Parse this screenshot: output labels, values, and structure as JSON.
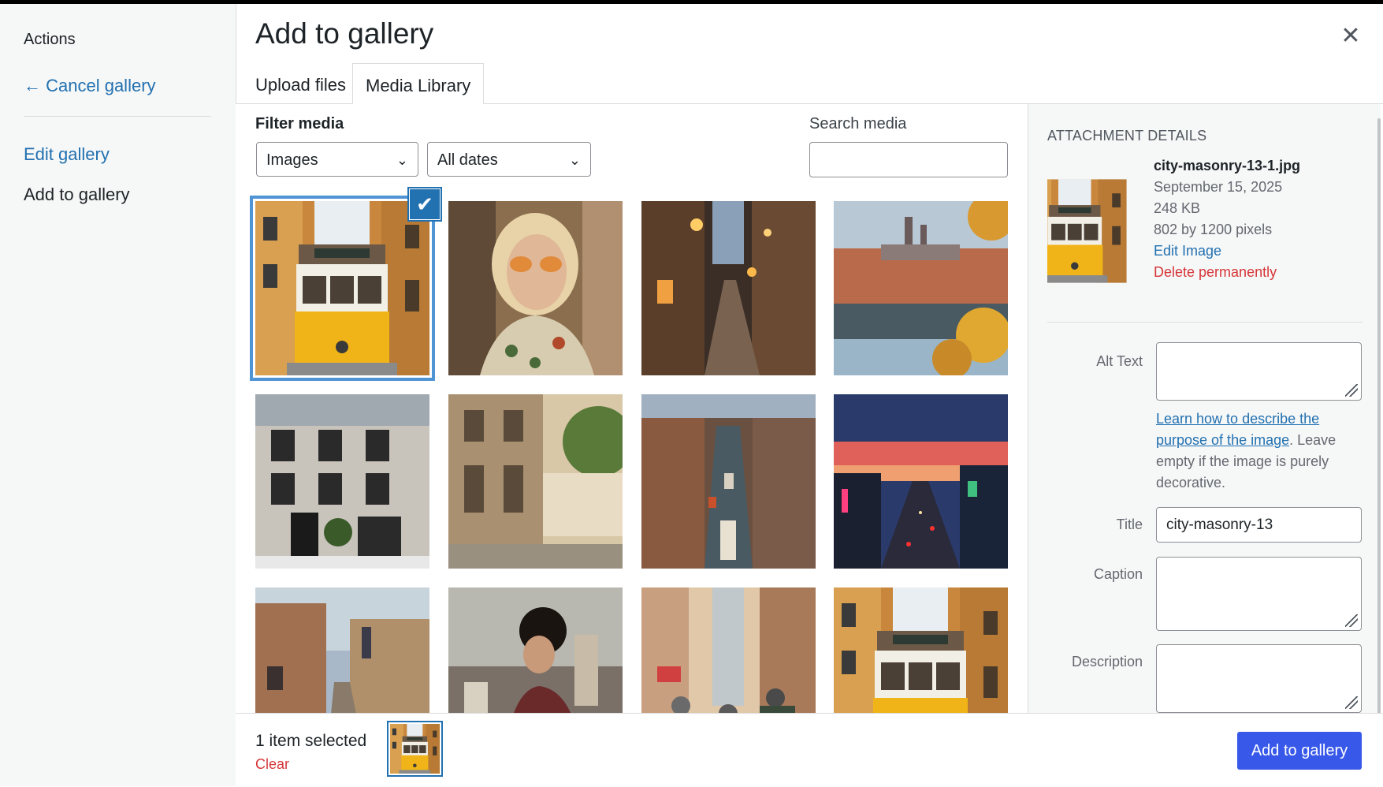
{
  "sidebar": {
    "heading": "Actions",
    "cancel_link": "← Cancel gallery",
    "edit_gallery": "Edit gallery",
    "add_to_gallery": "Add to gallery"
  },
  "modal": {
    "title": "Add to gallery",
    "close_icon": "close-icon"
  },
  "tabs": {
    "upload": "Upload files",
    "library": "Media Library",
    "active": "Media Library"
  },
  "filters": {
    "label": "Filter media",
    "type_value": "Images",
    "date_value": "All dates",
    "search_label": "Search media",
    "search_value": ""
  },
  "media_grid": {
    "items": [
      {
        "subject": "yellow tram in narrow street",
        "selected": true
      },
      {
        "subject": "woman with orange sunglasses",
        "selected": false
      },
      {
        "subject": "evening cobblestone alley",
        "selected": false
      },
      {
        "subject": "castle skyline over river",
        "selected": false
      },
      {
        "subject": "townhouse facade with greenery",
        "selected": false
      },
      {
        "subject": "sunlit boulevard with trees",
        "selected": false
      },
      {
        "subject": "canal with boats aerial view",
        "selected": false
      },
      {
        "subject": "sunset city avenue with traffic",
        "selected": false
      },
      {
        "subject": "old town street at dusk",
        "selected": false
      },
      {
        "subject": "woman overlooking skyline",
        "selected": false
      },
      {
        "subject": "cyclists in city street",
        "selected": false
      },
      {
        "subject": "yellow tram in narrow street",
        "selected": false
      }
    ]
  },
  "details": {
    "heading": "Attachment Details",
    "filename": "city-masonry-13-1.jpg",
    "date": "September 15, 2025",
    "filesize": "248 KB",
    "dimensions": "802 by 1200 pixels",
    "edit_link": "Edit Image",
    "delete_link": "Delete permanently",
    "alt_label": "Alt Text",
    "alt_value": "",
    "alt_help_link": "Learn how to describe the purpose of the image",
    "alt_help_text": ". Leave empty if the image is purely decorative.",
    "title_label": "Title",
    "title_value": "city-masonry-13",
    "caption_label": "Caption",
    "caption_value": "",
    "description_label": "Description",
    "description_value": ""
  },
  "toolbar": {
    "selection_count": "1 item selected",
    "clear_label": "Clear",
    "add_button": "Add to gallery"
  },
  "colors": {
    "accent": "#2271b1",
    "primary_button": "#3858e9",
    "danger": "#d63638"
  }
}
